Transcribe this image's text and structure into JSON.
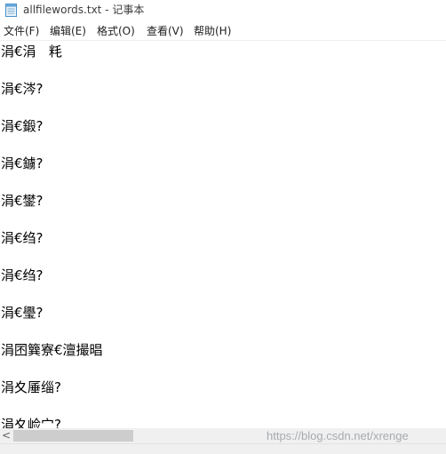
{
  "window": {
    "title": "allfilewords.txt - 记事本"
  },
  "menu": [
    {
      "label": "文件(F)"
    },
    {
      "label": "编辑(E)"
    },
    {
      "label": "格式(O)"
    },
    {
      "label": "查看(V)"
    },
    {
      "label": "帮助(H)"
    }
  ],
  "editor": {
    "lines": [
      "涓€涓   粍",
      "涓€涔?",
      "涓€鍛?",
      "涓€鐪?",
      "涓€鐢?",
      "涓€绉?",
      "涓€绉?",
      "涓€璺?",
      "涓囨簨寮€澶撮晿",
      "涓夊厜缁?",
      "涓夊崄宀?"
    ]
  },
  "scrollbar": {
    "left_arrow": "<"
  },
  "watermark": "https://blog.csdn.net/xrenge"
}
